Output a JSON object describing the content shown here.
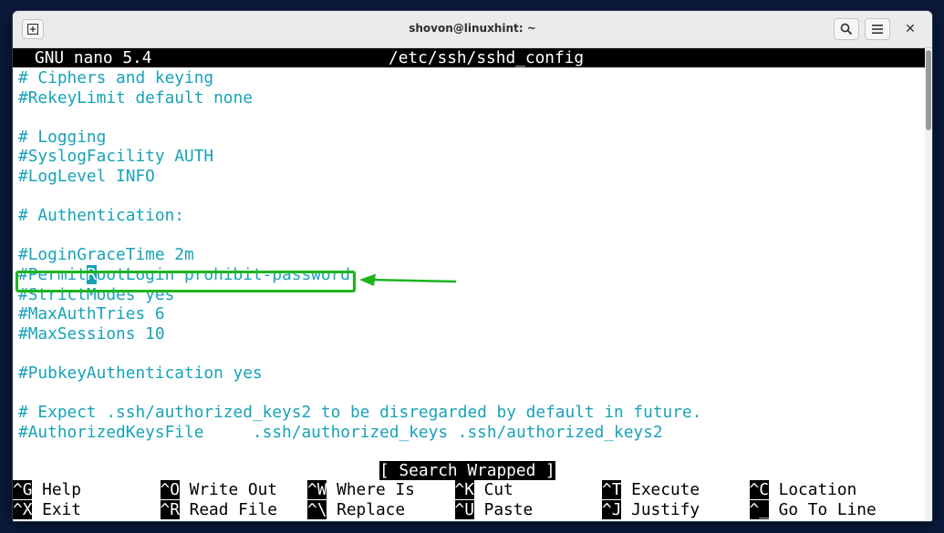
{
  "window": {
    "title": "shovon@linuxhint: ~",
    "icons": {
      "new_tab": "new-tab-icon",
      "search": "search-icon",
      "menu": "hamburger-menu-icon",
      "close": "close-icon"
    }
  },
  "nano": {
    "version_label": "GNU nano 5.4",
    "filename": "/etc/ssh/sshd_config",
    "status_message": "[ Search Wrapped ]",
    "lines": [
      "# Ciphers and keying",
      "#RekeyLimit default none",
      "",
      "# Logging",
      "#SyslogFacility AUTH",
      "#LogLevel INFO",
      "",
      "# Authentication:",
      "",
      "#LoginGraceTime 2m",
      "",
      "#StrictModes yes",
      "#MaxAuthTries 6",
      "#MaxSessions 10",
      "",
      "#PubkeyAuthentication yes",
      "",
      "# Expect .ssh/authorized_keys2 to be disregarded by default in future.",
      "#AuthorizedKeysFile     .ssh/authorized_keys .ssh/authorized_keys2"
    ],
    "cursor_line": {
      "before": "#Permit",
      "cursor_char": "R",
      "after": "ootLogin prohibit-password"
    },
    "shortcuts": [
      {
        "key": "^G",
        "label": "Help"
      },
      {
        "key": "^O",
        "label": "Write Out"
      },
      {
        "key": "^W",
        "label": "Where Is"
      },
      {
        "key": "^K",
        "label": "Cut"
      },
      {
        "key": "^T",
        "label": "Execute"
      },
      {
        "key": "^C",
        "label": "Location"
      },
      {
        "key": "^X",
        "label": "Exit"
      },
      {
        "key": "^R",
        "label": "Read File"
      },
      {
        "key": "^\\",
        "label": "Replace"
      },
      {
        "key": "^U",
        "label": "Paste"
      },
      {
        "key": "^J",
        "label": "Justify"
      },
      {
        "key": "^_",
        "label": "Go To Line"
      }
    ]
  },
  "annotation": {
    "color": "#1fb41f"
  },
  "colors": {
    "text": "#17a2b8",
    "header_bg": "#000000",
    "background": "#ffffff"
  }
}
